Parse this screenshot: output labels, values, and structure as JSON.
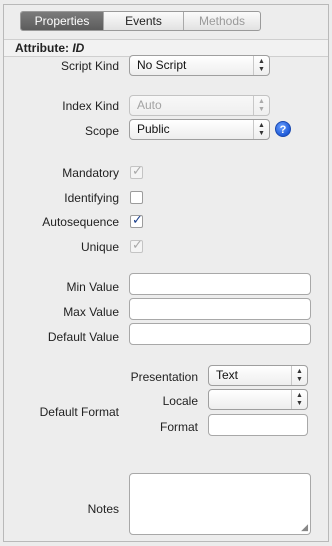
{
  "tabs": [
    {
      "label": "Properties",
      "state": "selected"
    },
    {
      "label": "Events",
      "state": "normal"
    },
    {
      "label": "Methods",
      "state": "disabled"
    }
  ],
  "attribute": {
    "prefix": "Attribute:",
    "name": "ID"
  },
  "fields": {
    "script_kind": {
      "label": "Script Kind",
      "value": "No Script"
    },
    "index_kind": {
      "label": "Index Kind",
      "value": "Auto",
      "enabled": false
    },
    "scope": {
      "label": "Scope",
      "value": "Public"
    },
    "help_glyph": "?",
    "mandatory": {
      "label": "Mandatory",
      "checked": true,
      "enabled": false
    },
    "identifying": {
      "label": "Identifying",
      "checked": false,
      "enabled": true
    },
    "autosequence": {
      "label": "Autosequence",
      "checked": true,
      "enabled": true
    },
    "unique": {
      "label": "Unique",
      "checked": true,
      "enabled": false
    },
    "min_value": {
      "label": "Min Value",
      "value": ""
    },
    "max_value": {
      "label": "Max Value",
      "value": ""
    },
    "default_value": {
      "label": "Default Value",
      "value": ""
    },
    "default_format": {
      "label": "Default Format"
    },
    "presentation": {
      "label": "Presentation",
      "value": "Text"
    },
    "locale": {
      "label": "Locale",
      "value": ""
    },
    "format": {
      "label": "Format",
      "value": ""
    },
    "notes": {
      "label": "Notes",
      "value": ""
    }
  },
  "glyphs": {
    "check": "✓",
    "arrows_up": "▲",
    "arrows_down": "▼",
    "resize": "◢"
  },
  "colors": {
    "selected_tab": "#666666",
    "checkbox_active": "#1b3f8c",
    "help_icon": "#1f5bd8"
  }
}
